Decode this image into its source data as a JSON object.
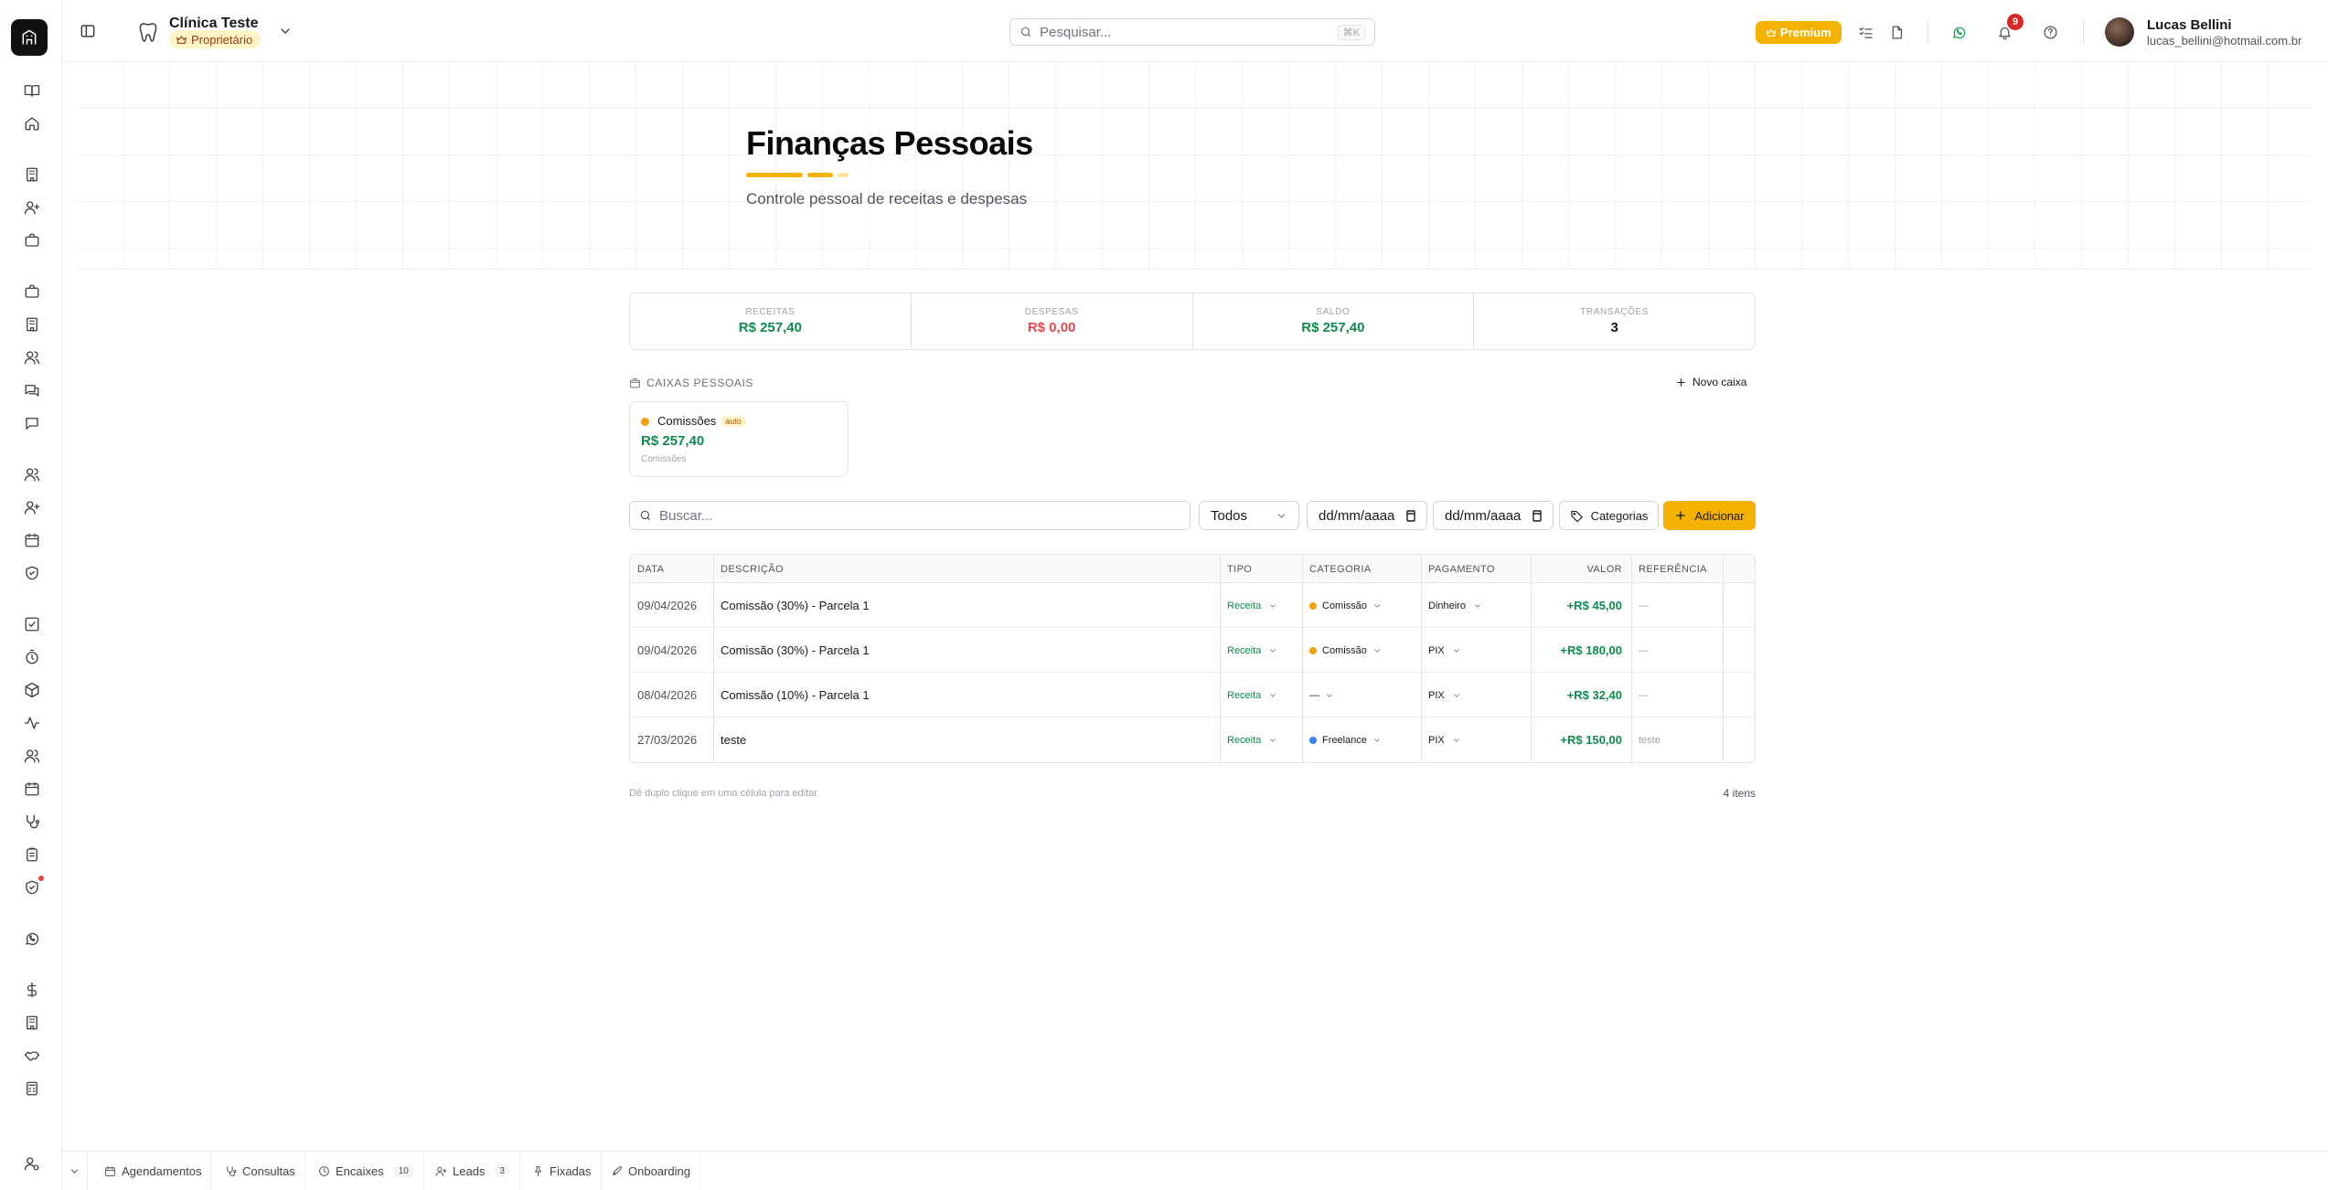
{
  "header": {
    "clinic_name": "Clínica Teste",
    "role": "Proprietário",
    "search_placeholder": "Pesquisar...",
    "search_shortcut": "⌘K",
    "premium_label": "Premium",
    "notification_count": "9",
    "user_name": "Lucas Bellini",
    "user_email": "lucas_bellini@hotmail.com.br"
  },
  "page": {
    "title": "Finanças Pessoais",
    "subtitle": "Controle pessoal de receitas e despesas"
  },
  "stats": [
    {
      "label": "RECEITAS",
      "value": "R$ 257,40",
      "color": "#0f8a4f"
    },
    {
      "label": "DESPESAS",
      "value": "R$ 0,00",
      "color": "#e5484d"
    },
    {
      "label": "SALDO",
      "value": "R$ 257,40",
      "color": "#0f8a4f"
    },
    {
      "label": "TRANSAÇÕES",
      "value": "3",
      "color": "#18181b"
    }
  ],
  "caixas": {
    "heading": "CAIXAS PESSOAIS",
    "new_label": "Novo caixa",
    "items": [
      {
        "name": "Comissões",
        "badge": "auto",
        "value": "R$ 257,40",
        "subtitle": "Comissões"
      }
    ]
  },
  "filters": {
    "search_placeholder": "Buscar...",
    "type_value": "Todos",
    "date_from_placeholder": "dd/mm/aaaa",
    "date_to_placeholder": "dd/mm/aaaa",
    "categories_label": "Categorias",
    "add_label": "Adicionar"
  },
  "table": {
    "columns": [
      "DATA",
      "DESCRIÇÃO",
      "TIPO",
      "CATEGORIA",
      "PAGAMENTO",
      "VALOR",
      "REFERÊNCIA"
    ],
    "rows": [
      {
        "date": "09/04/2026",
        "description": "Comissão (30%) - Parcela 1",
        "type": "Receita",
        "category": "Comissão",
        "category_color": "#f59e0b",
        "payment": "Dinheiro",
        "value": "+R$ 45,00",
        "reference": "—"
      },
      {
        "date": "09/04/2026",
        "description": "Comissão (30%) - Parcela 1",
        "type": "Receita",
        "category": "Comissão",
        "category_color": "#f59e0b",
        "payment": "PIX",
        "value": "+R$ 180,00",
        "reference": "—"
      },
      {
        "date": "08/04/2026",
        "description": "Comissão (10%) - Parcela 1",
        "type": "Receita",
        "category": "—",
        "category_color": "",
        "payment": "PIX",
        "value": "+R$ 32,40",
        "reference": "—"
      },
      {
        "date": "27/03/2026",
        "description": "teste",
        "type": "Receita",
        "category": "Freelance",
        "category_color": "#3b82f6",
        "payment": "PIX",
        "value": "+R$ 150,00",
        "reference": "teste"
      }
    ],
    "hint": "Dê duplo clique em uma célula para editar",
    "count_label": "4 itens"
  },
  "bottom_tabs": [
    {
      "label": "Agendamentos",
      "icon": "calendar-icon",
      "count": ""
    },
    {
      "label": "Consultas",
      "icon": "stethoscope-icon",
      "count": ""
    },
    {
      "label": "Encaixes",
      "icon": "clock-icon",
      "count": "10"
    },
    {
      "label": "Leads",
      "icon": "user-plus-icon",
      "count": "3"
    },
    {
      "label": "Fixadas",
      "icon": "pin-icon",
      "count": ""
    },
    {
      "label": "Onboarding",
      "icon": "rocket-icon",
      "count": ""
    }
  ],
  "colors": {
    "accent": "#f5b301",
    "positive": "#0f8a4f",
    "negative": "#e5484d"
  }
}
